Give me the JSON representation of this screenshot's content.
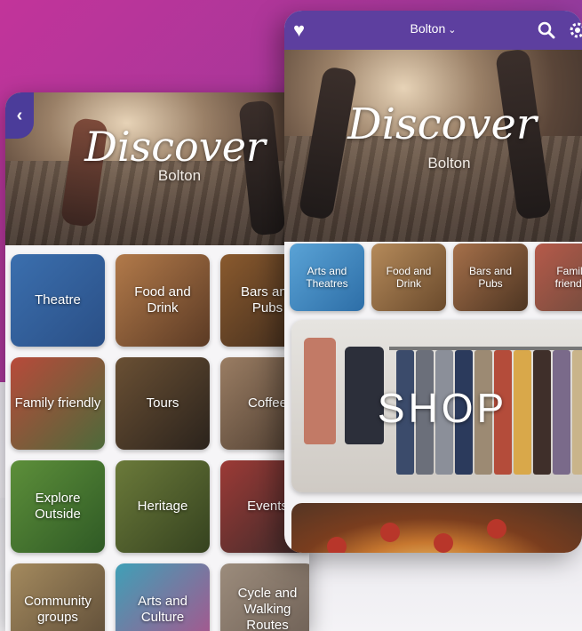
{
  "back_screen": {
    "hero": {
      "title": "Discover",
      "subtitle": "Bolton"
    },
    "back_glyph": "‹",
    "tiles": [
      {
        "label": "Theatre",
        "colors": [
          "#3b6fae",
          "#2a4f86"
        ]
      },
      {
        "label": "Food and Drink",
        "colors": [
          "#b27a4a",
          "#5b3a24"
        ]
      },
      {
        "label": "Bars and Pubs",
        "colors": [
          "#8a5a2e",
          "#3d2a1c"
        ]
      },
      {
        "label": "Family friendly",
        "colors": [
          "#b84a3a",
          "#4d6a3a"
        ]
      },
      {
        "label": "Tours",
        "colors": [
          "#6a5034",
          "#2b231c"
        ]
      },
      {
        "label": "Coffee",
        "colors": [
          "#9a7d63",
          "#4a3a2e"
        ]
      },
      {
        "label": "Explore Outside",
        "colors": [
          "#5d8f3a",
          "#2f5a25"
        ]
      },
      {
        "label": "Heritage",
        "colors": [
          "#6b7a3a",
          "#35421f"
        ]
      },
      {
        "label": "Events",
        "colors": [
          "#9c3a36",
          "#3b2a2a"
        ]
      },
      {
        "label": "Community groups",
        "colors": [
          "#a48a5e",
          "#5b4a36"
        ]
      },
      {
        "label": "Arts and Culture",
        "colors": [
          "#3fa0b7",
          "#b0508a"
        ]
      },
      {
        "label": "Cycle and Walking Routes",
        "colors": [
          "#9c8c7c",
          "#6a5c52"
        ]
      }
    ]
  },
  "front_screen": {
    "topbar": {
      "location": "Bolton",
      "heart_glyph": "♥",
      "chevron_glyph": "⌄",
      "color": "#5d3f9f"
    },
    "hero": {
      "title": "Discover",
      "subtitle": "Bolton"
    },
    "category_row": [
      {
        "label": "Arts and Theatres",
        "colors": [
          "#5aa3d6",
          "#2d6ea7"
        ]
      },
      {
        "label": "Food and Drink",
        "colors": [
          "#b58a5a",
          "#6a4a2c"
        ]
      },
      {
        "label": "Bars and Pubs",
        "colors": [
          "#a6704a",
          "#4d3522"
        ]
      },
      {
        "label": "Family friendly",
        "colors": [
          "#b65a4a",
          "#6b4a3c"
        ]
      }
    ],
    "shop_label": "SHOP"
  }
}
